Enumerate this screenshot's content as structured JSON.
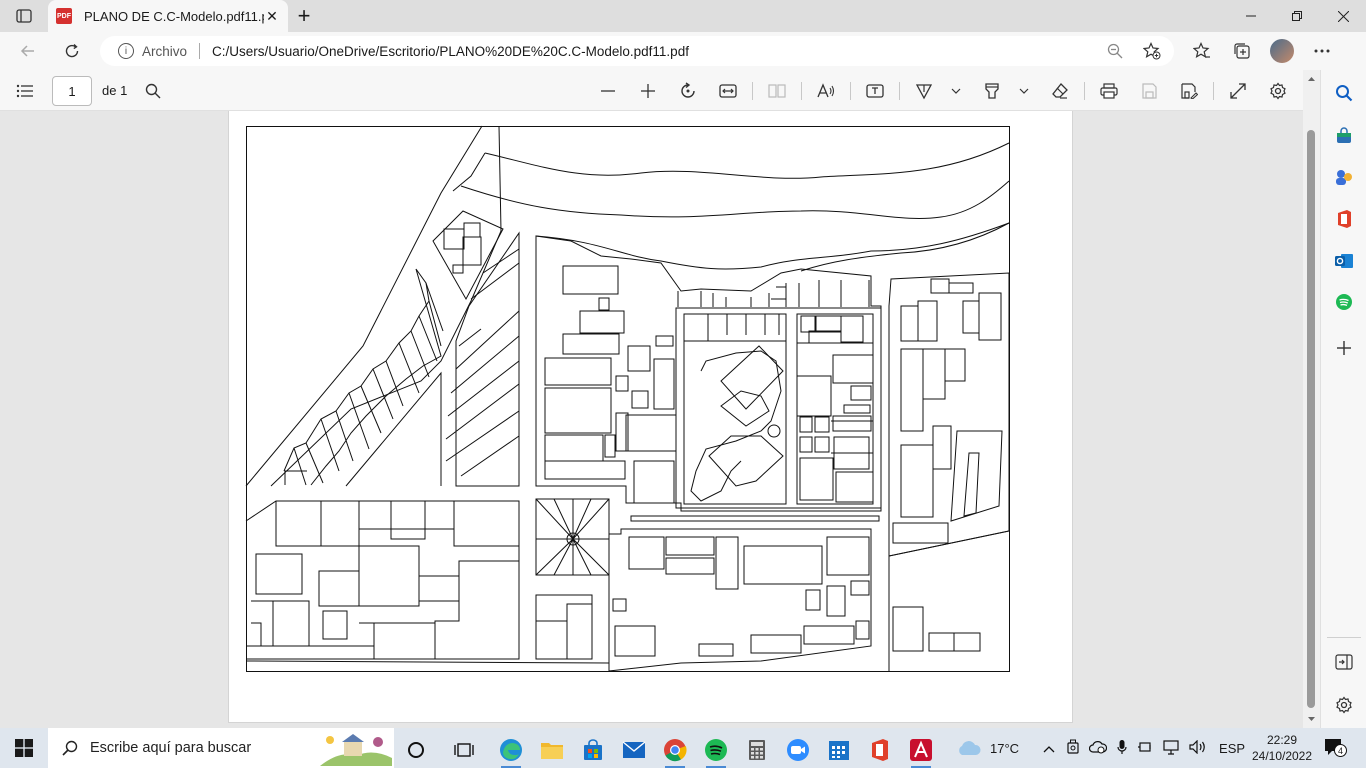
{
  "browser": {
    "tab": {
      "title": "PLANO DE C.C-Modelo.pdf11.pdf",
      "close": "✕",
      "icon_label": "PDF"
    },
    "new_tab": "+",
    "address": {
      "scheme": "Archivo",
      "url": "C:/Users/Usuario/OneDrive/Escritorio/PLANO%20DE%20C.C-Modelo.pdf11.pdf"
    }
  },
  "pdf_toolbar": {
    "page_current": "1",
    "page_total": "de 1"
  },
  "taskbar": {
    "search_placeholder": "Escribe aquí para buscar",
    "weather": "17°C",
    "lang": "ESP",
    "time": "22:29",
    "date": "24/10/2022",
    "notifications": "4"
  },
  "colors": {
    "accent": "#0067c0",
    "pdf_red": "#d5312f",
    "page_bg": "#ffffff",
    "viewer_bg": "#e6e6e6",
    "chrome_bg": "#f7f7f7"
  }
}
